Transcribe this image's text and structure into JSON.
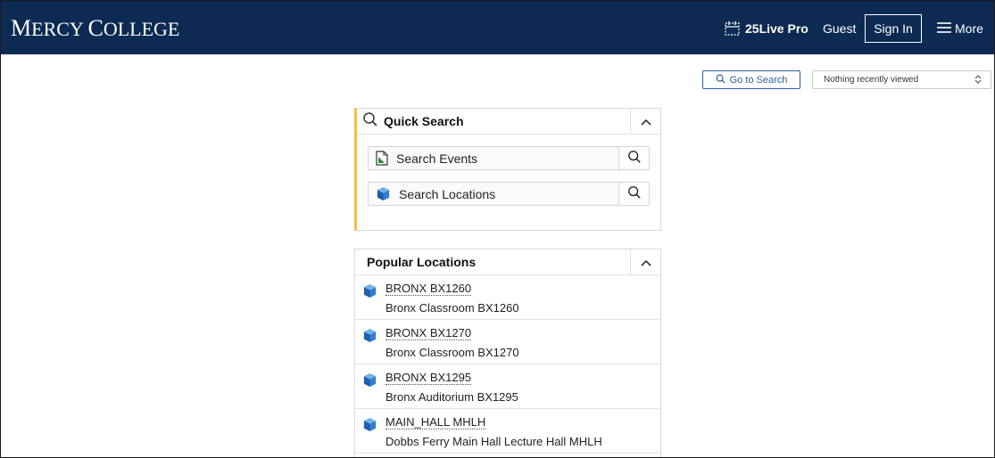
{
  "header": {
    "logo_first": "M",
    "logo_rest": "ERCY ",
    "logo_second_first": "C",
    "logo_second_rest": "OLLEGE",
    "brand_label": "25Live Pro",
    "guest_label": "Guest",
    "signin_label": "Sign In",
    "more_label": "More"
  },
  "toolbar": {
    "go_to_search_label": "Go to Search",
    "recent_value": "Nothing recently viewed"
  },
  "quick_search": {
    "title": "Quick Search",
    "rows": [
      {
        "label": "Search Events",
        "icon": "event-document-icon"
      },
      {
        "label": "Search Locations",
        "icon": "location-cube-icon"
      }
    ]
  },
  "popular_locations": {
    "title": "Popular Locations",
    "items": [
      {
        "code": "BRONX BX1260",
        "name": "Bronx Classroom BX1260"
      },
      {
        "code": "BRONX BX1270",
        "name": "Bronx Classroom BX1270"
      },
      {
        "code": "BRONX BX1295",
        "name": "Bronx Auditorium BX1295"
      },
      {
        "code": "MAIN_HALL MHLH",
        "name": "Dobbs Ferry Main Hall Lecture Hall MHLH"
      }
    ]
  },
  "colors": {
    "header_bg": "#0c2a52",
    "accent_blue": "#2b5fa6",
    "quick_search_accent": "#f0c13a"
  }
}
